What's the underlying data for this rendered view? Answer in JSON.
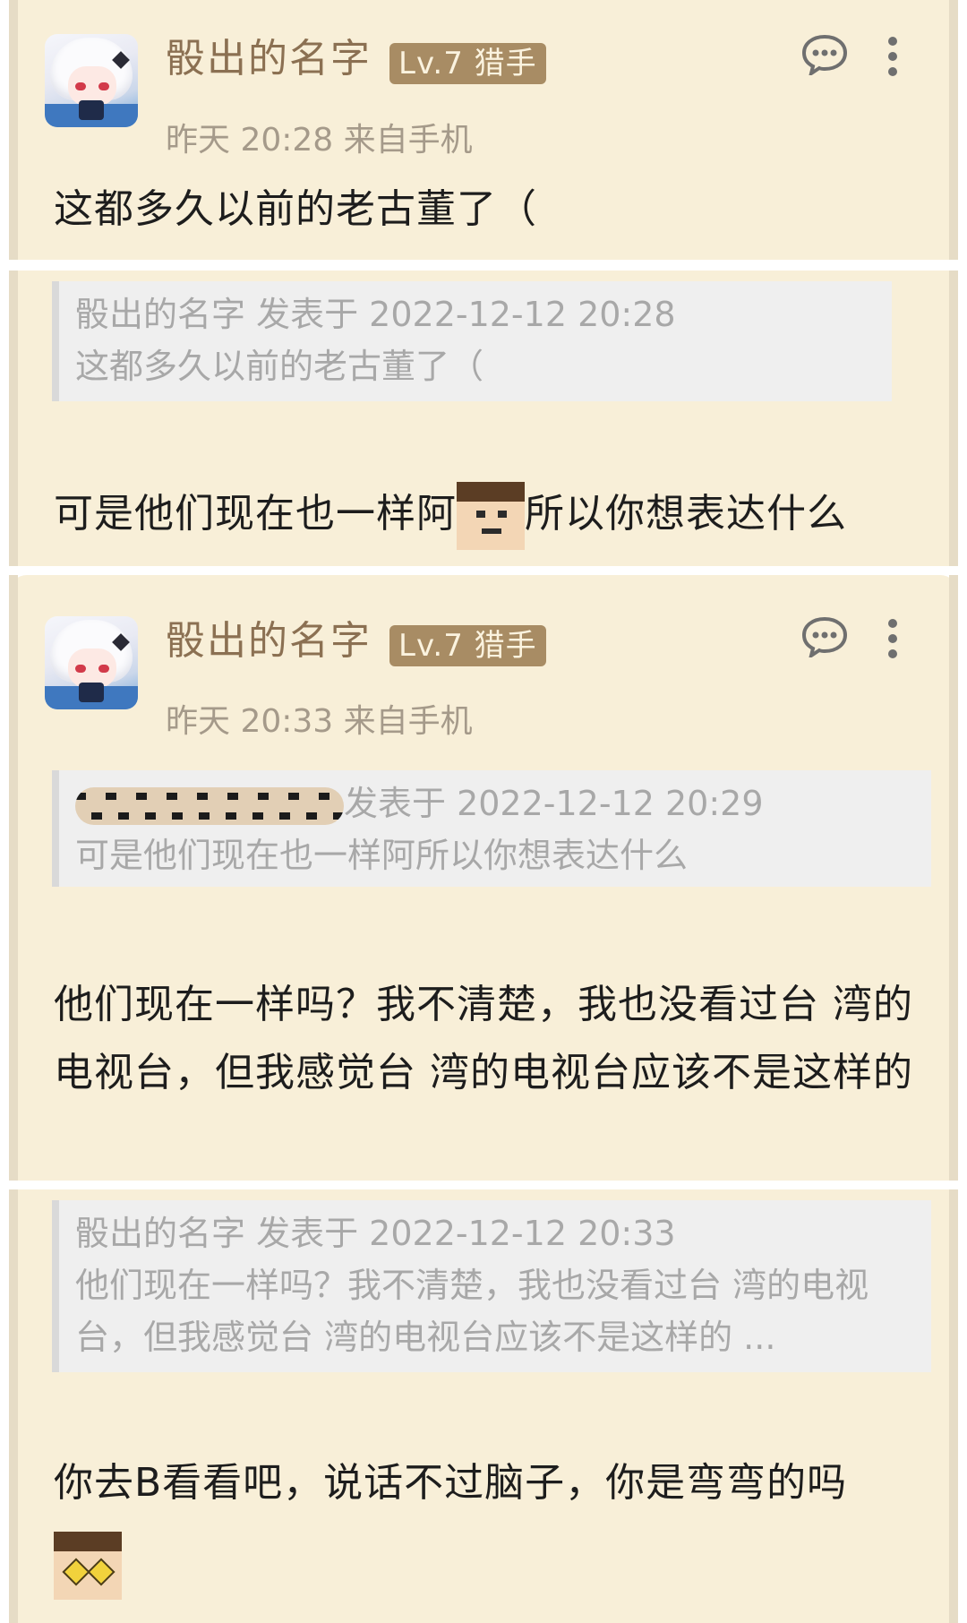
{
  "posts": [
    {
      "username": "骰出的名字",
      "level": "Lv.7 猎手",
      "meta": "昨天 20:28 来自手机",
      "text": "这都多久以前的老古董了（"
    },
    {
      "quote_header": "骰出的名字 发表于 2022-12-12 20:28",
      "quote_body": "这都多久以前的老古董了（",
      "text_before_emoji": "可是他们现在也一样阿",
      "text_after_emoji": "所以你想表达什么"
    },
    {
      "username": "骰出的名字",
      "level": "Lv.7 猎手",
      "meta": "昨天 20:33 来自手机",
      "quote_header_suffix": "发表于 2022-12-12 20:29",
      "quote_body": "可是他们现在也一样阿所以你想表达什么",
      "text": "他们现在一样吗？我不清楚，我也没看过台 湾的电视台，但我感觉台 湾的电视台应该不是这样的"
    },
    {
      "quote_header": "骰出的名字 发表于 2022-12-12 20:33",
      "quote_body": "他们现在一样吗？我不清楚，我也没看过台 湾的电视台，但我感觉台 湾的电视台应该不是这样的 ...",
      "text": "你去B看看吧，说话不过脑子，你是弯弯的吗"
    }
  ],
  "colors": {
    "card_bg": "#f8efd8",
    "username": "#8b7052",
    "level_badge": "#a88c64",
    "quote_bg": "#efefef"
  },
  "icons": [
    "avatar",
    "comment-icon",
    "more-vertical-icon",
    "pixel-face-emoji",
    "star-eyes-emoji"
  ]
}
